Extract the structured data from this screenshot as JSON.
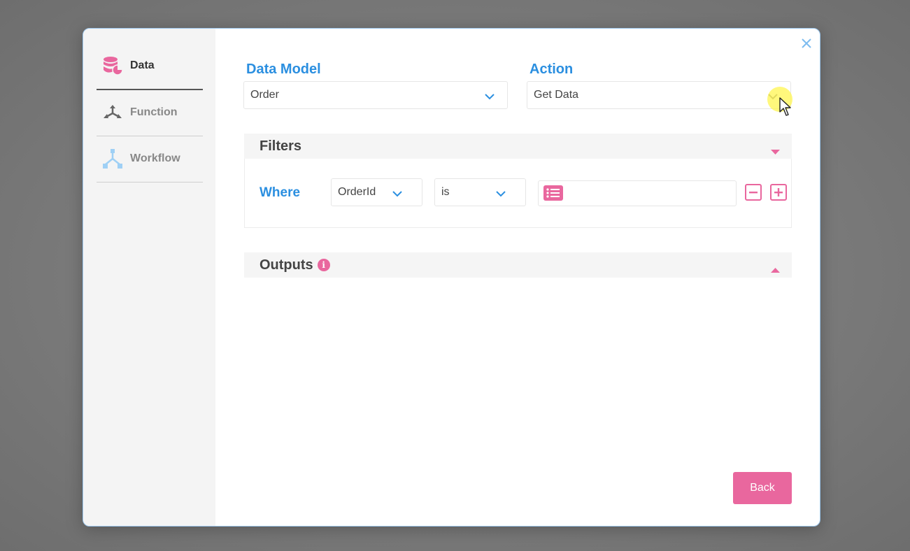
{
  "sidebar": {
    "items": [
      {
        "label": "Data",
        "icon": "database-icon",
        "active": true
      },
      {
        "label": "Function",
        "icon": "function-icon",
        "active": false
      },
      {
        "label": "Workflow",
        "icon": "workflow-icon",
        "active": false
      }
    ]
  },
  "form": {
    "data_model": {
      "title": "Data Model",
      "value": "Order"
    },
    "action": {
      "title": "Action",
      "value": "Get Data"
    }
  },
  "filters": {
    "title": "Filters",
    "where_label": "Where",
    "field": "OrderId",
    "operator": "is",
    "value": ""
  },
  "outputs": {
    "title": "Outputs",
    "info_icon": "info-icon",
    "info_glyph": "i"
  },
  "footer": {
    "back_label": "Back"
  },
  "colors": {
    "accent_blue": "#2b8fe0",
    "accent_pink": "#e9679e"
  }
}
